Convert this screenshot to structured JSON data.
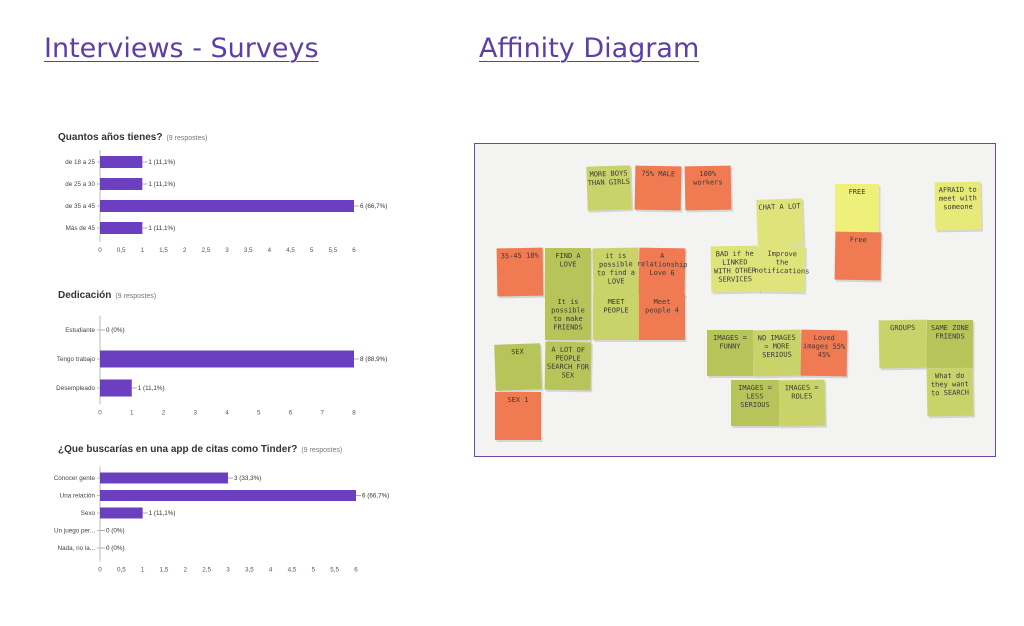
{
  "headings": {
    "left": "Interviews - Surveys",
    "right": "Affinity Diagram"
  },
  "chart_data": [
    {
      "type": "bar",
      "orientation": "horizontal",
      "title": "Quantos años tienes?",
      "subtitle": "(9 respostes)",
      "categories": [
        "de 18 a 25",
        "de 25 a 30",
        "de 35 a 45",
        "Más de 45"
      ],
      "values": [
        1,
        1,
        6,
        1
      ],
      "value_labels": [
        "1 (11,1%)",
        "1 (11,1%)",
        "6 (66,7%)",
        "1 (11,1%)"
      ],
      "xlim": [
        0,
        6
      ],
      "ticks": [
        "0",
        "0,5",
        "1",
        "1,5",
        "2",
        "2,5",
        "3",
        "3,5",
        "4",
        "4,5",
        "5",
        "5,5",
        "6"
      ],
      "tick_values": [
        0,
        0.5,
        1,
        1.5,
        2,
        2.5,
        3,
        3.5,
        4,
        4.5,
        5,
        5.5,
        6
      ],
      "color": "#6b3fbf"
    },
    {
      "type": "bar",
      "orientation": "horizontal",
      "title": "Dedicación",
      "subtitle": "(9 respostes)",
      "categories": [
        "Estudiante",
        "Tengo trabajo",
        "Desempleado"
      ],
      "values": [
        0,
        8,
        1
      ],
      "value_labels": [
        "0 (0%)",
        "8 (88,9%)",
        "1 (11,1%)"
      ],
      "xlim": [
        0,
        8
      ],
      "ticks": [
        "0",
        "1",
        "2",
        "3",
        "4",
        "5",
        "6",
        "7",
        "8"
      ],
      "tick_values": [
        0,
        1,
        2,
        3,
        4,
        5,
        6,
        7,
        8
      ],
      "color": "#6b3fbf"
    },
    {
      "type": "bar",
      "orientation": "horizontal",
      "title": "¿Que buscarías en una app de citas como Tinder?",
      "subtitle": "(9 respostes)",
      "categories": [
        "Conocer gente",
        "Una relación",
        "Sexo",
        "Un juego per...",
        "Nada, no la..."
      ],
      "values": [
        3,
        6,
        1,
        0,
        0
      ],
      "value_labels": [
        "3 (33,3%)",
        "6 (66,7%)",
        "1 (11,1%)",
        "0 (0%)",
        "0 (0%)"
      ],
      "xlim": [
        0,
        6
      ],
      "ticks": [
        "0",
        "0,5",
        "1",
        "1,5",
        "2",
        "2,5",
        "3",
        "3,5",
        "4",
        "4,5",
        "5",
        "5,5",
        "6"
      ],
      "tick_values": [
        0,
        0.5,
        1,
        1.5,
        2,
        2.5,
        3,
        3.5,
        4,
        4.5,
        5,
        5.5,
        6
      ],
      "color": "#6b3fbf"
    }
  ],
  "affinity_photo": {
    "colors": {
      "yellow_green": "#c9d36a",
      "orange": "#f07a52",
      "light_yellow": "#eef07a",
      "green": "#b7c45a"
    },
    "notes": [
      {
        "text": "MORE BOYS THAN GIRLS",
        "color": "#c9d36a"
      },
      {
        "text": "75% MALE",
        "color": "#f07a52"
      },
      {
        "text": "100% workers",
        "color": "#f07a52"
      },
      {
        "text": "CHAT A LOT",
        "color": "#dfe47a"
      },
      {
        "text": "FREE",
        "color": "#eef07a"
      },
      {
        "text": "Free",
        "color": "#f07a52"
      },
      {
        "text": "AFRAID to meet with someone",
        "color": "#e6ea78"
      },
      {
        "text": "35-45 18%",
        "color": "#f07a52"
      },
      {
        "text": "FIND A LOVE",
        "color": "#b7c45a"
      },
      {
        "text": "it is possible to find a LOVE",
        "color": "#c9d36a"
      },
      {
        "text": "A relationship Love 6",
        "color": "#f07a52"
      },
      {
        "text": "It is possible to make FRIENDS",
        "color": "#b7c45a"
      },
      {
        "text": "MEET PEOPLE",
        "color": "#c9d36a"
      },
      {
        "text": "Meet people 4",
        "color": "#f07a52"
      },
      {
        "text": "BAD if he LINKED WITH OTHER SERVICES",
        "color": "#dfe47a"
      },
      {
        "text": "Improve the notifications",
        "color": "#dfe47a"
      },
      {
        "text": "SEX",
        "color": "#b7c45a"
      },
      {
        "text": "A LOT OF PEOPLE SEARCH FOR SEX",
        "color": "#b7c45a"
      },
      {
        "text": "SEX 1",
        "color": "#f07a52"
      },
      {
        "text": "IMAGES = FUNNY",
        "color": "#b7c45a"
      },
      {
        "text": "NO IMAGES = MORE SERIOUS",
        "color": "#c9d36a"
      },
      {
        "text": "Loved images 55% 45%",
        "color": "#f07a52"
      },
      {
        "text": "IMAGES = LESS SERIOUS",
        "color": "#b7c45a"
      },
      {
        "text": "IMAGES = ROLES",
        "color": "#c9d36a"
      },
      {
        "text": "GROUPS",
        "color": "#c9d36a"
      },
      {
        "text": "SAME ZONE FRIENDS",
        "color": "#b7c45a"
      },
      {
        "text": "What do they want to SEARCH",
        "color": "#c9d36a"
      }
    ]
  }
}
